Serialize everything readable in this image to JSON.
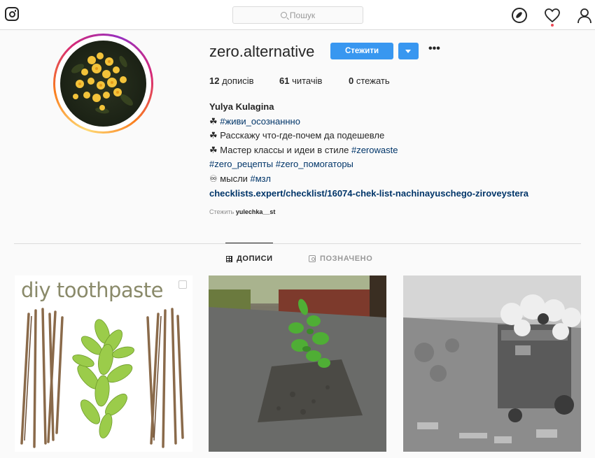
{
  "header": {
    "search_placeholder": "Пошук"
  },
  "profile": {
    "username": "zero.alternative",
    "follow_label": "Стежити",
    "more_label": "•••",
    "stats": {
      "posts_count": "12",
      "posts_label": "дописів",
      "followers_count": "61",
      "followers_label": "читачів",
      "following_count": "0",
      "following_label": "стежать"
    },
    "full_name": "Yulya Kulagina",
    "bio_lines": [
      {
        "prefix": "☘ ",
        "text": "",
        "tag": "#живи_осознаннно"
      },
      {
        "prefix": "☘ ",
        "text": "Расскажу что-где-почем да подешевле",
        "tag": ""
      },
      {
        "prefix": "☘ ",
        "text": "Мастер классы и идеи в стиле ",
        "tag": "#zerowaste"
      },
      {
        "prefix": "",
        "text": "",
        "tag": "#zero_рецепты #zero_помогаторы"
      },
      {
        "prefix": "♾ ",
        "text": "мысли ",
        "tag": "#мзл"
      }
    ],
    "website": "checklists.expert/checklist/16074-chek-list-nachinayuschego-ziroveystera",
    "followed_by_label": "Стежить",
    "followed_by_user": "yulechka__st"
  },
  "tabs": [
    {
      "label": "ДОПИСИ",
      "active": true
    },
    {
      "label": "ПОЗНАЧЕНО",
      "active": false
    }
  ],
  "posts": [
    {
      "caption_text": "diy toothpaste",
      "type": "carousel"
    },
    {
      "caption_text": "",
      "type": "photo"
    },
    {
      "caption_text": "",
      "type": "photo"
    }
  ],
  "colors": {
    "accent": "#3897f0",
    "notification_dot": "#ed4956",
    "hashtag": "#003569"
  },
  "icons": [
    "instagram-logo-icon",
    "search-icon",
    "compass-icon",
    "heart-icon",
    "profile-icon",
    "grid-icon",
    "tagged-icon",
    "carousel-icon"
  ]
}
